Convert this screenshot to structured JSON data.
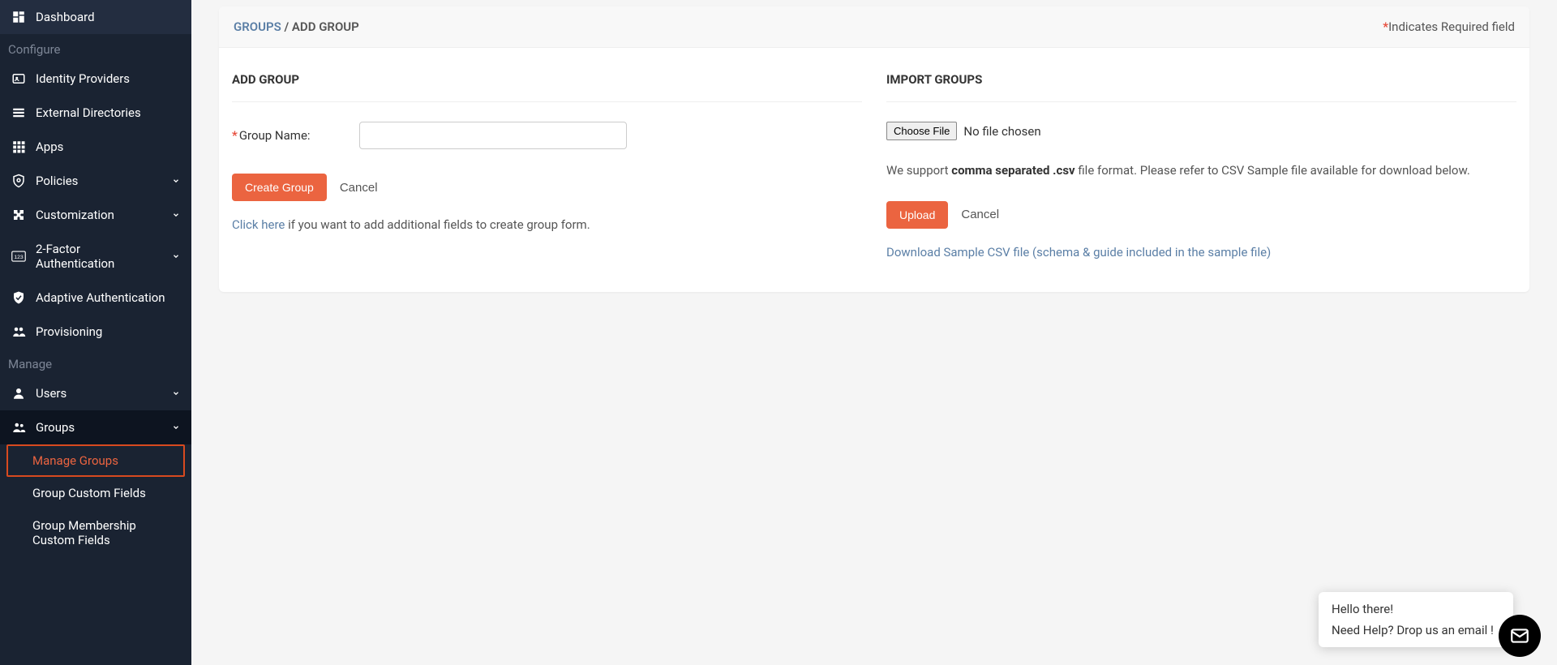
{
  "sidebar": {
    "top": {
      "dashboard": "Dashboard"
    },
    "section_configure": "Configure",
    "configure": {
      "idp": "Identity Providers",
      "extdir": "External Directories",
      "apps": "Apps",
      "policies": "Policies",
      "customization": "Customization",
      "twofa": "2-Factor Authentication",
      "adaptive": "Adaptive Authentication",
      "provisioning": "Provisioning"
    },
    "section_manage": "Manage",
    "manage": {
      "users": "Users",
      "groups": "Groups"
    },
    "groups_sub": {
      "manage_groups": "Manage Groups",
      "custom_fields": "Group Custom Fields",
      "membership_fields": "Group Membership Custom Fields"
    }
  },
  "header": {
    "breadcrumb_link": "GROUPS",
    "breadcrumb_sep": "/",
    "breadcrumb_current": "ADD GROUP",
    "required_note": "Indicates Required field"
  },
  "add_group": {
    "title": "ADD GROUP",
    "label_name": "Group Name:",
    "create_btn": "Create Group",
    "cancel_btn": "Cancel",
    "hint_link": "Click here",
    "hint_text": " if you want to add additional fields to create group form."
  },
  "import": {
    "title": "IMPORT GROUPS",
    "choose_file": "Choose File",
    "no_file": "No file chosen",
    "support_pre": "We support ",
    "support_bold": "comma separated .csv",
    "support_post": " file format. Please refer to CSV Sample file available for download below.",
    "upload_btn": "Upload",
    "cancel_btn": "Cancel",
    "download_link": "Download Sample CSV file (schema & guide included in the sample file)"
  },
  "chat": {
    "line1": "Hello there!",
    "line2": "Need Help? Drop us an email !"
  }
}
